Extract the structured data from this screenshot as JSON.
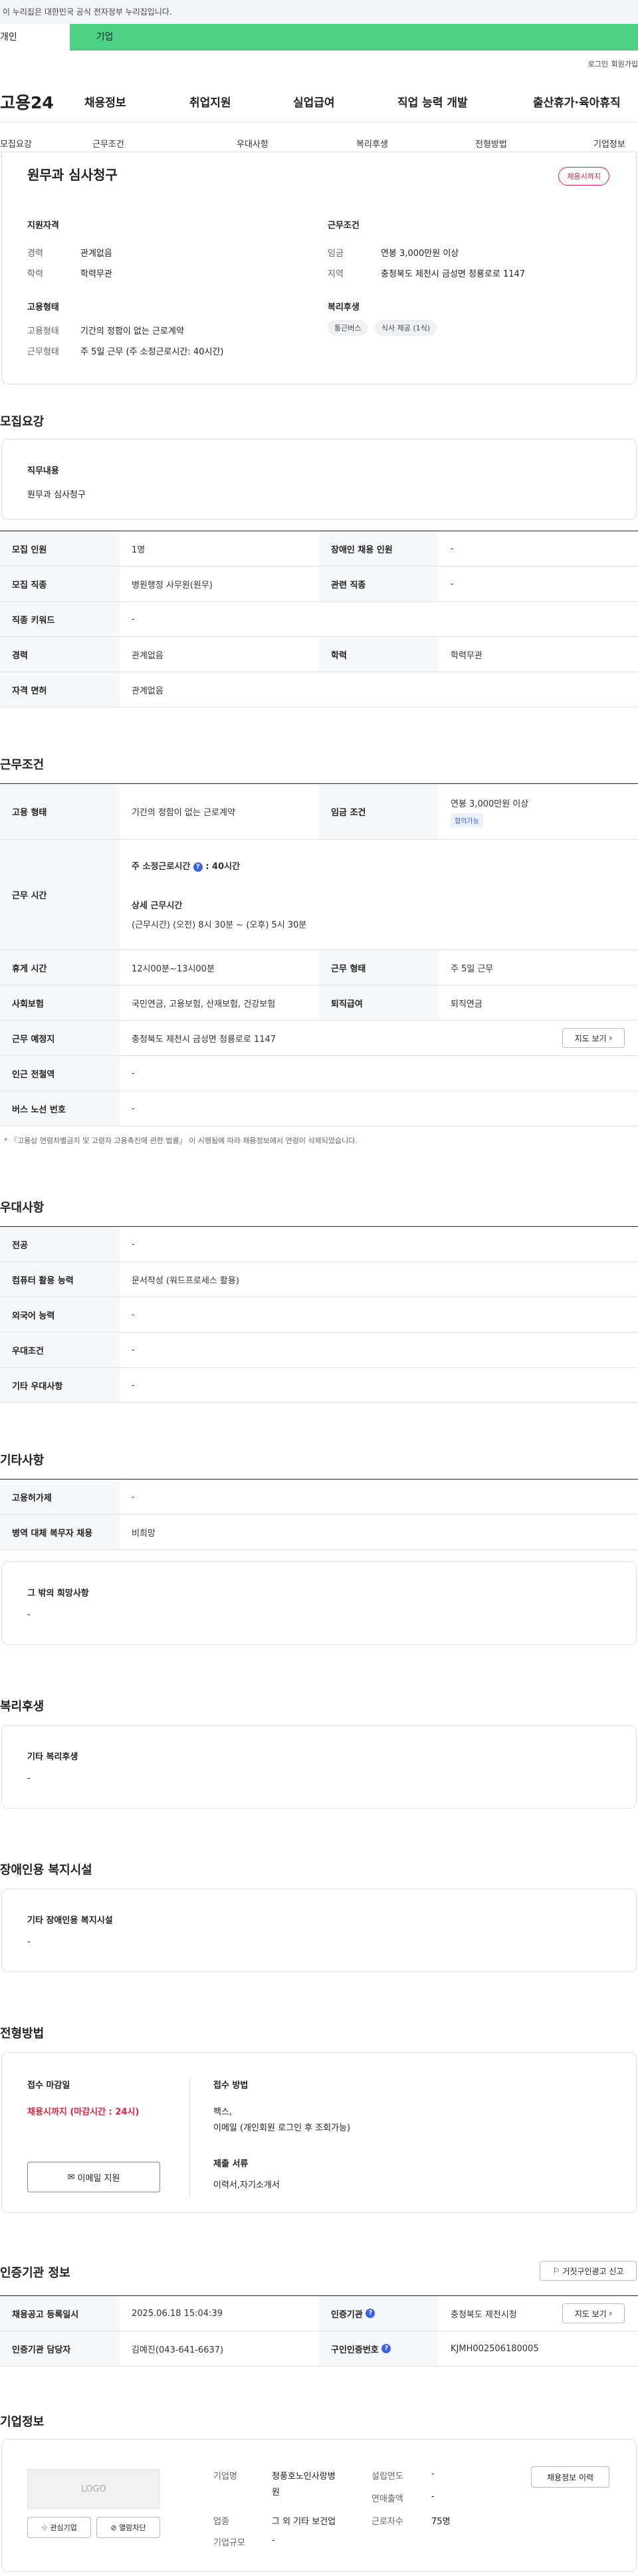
{
  "gov_banner": "이 누리집은 대한민국 공식 전자정부 누리집입니다.",
  "user_tabs": [
    "개인",
    "기업"
  ],
  "top_links": [
    "로그인",
    "회원가입"
  ],
  "logo": "고용24",
  "gnb": [
    "채용정보",
    "취업지원",
    "실업급여",
    "직업 능력 개발",
    "출산휴가·육아휴직"
  ],
  "subnav": [
    "모집요강",
    "근무조건",
    "우대사항",
    "복리후생",
    "전형방법",
    "기업정보"
  ],
  "summary": {
    "title": "원무과 심사청구",
    "status": "채용시까지",
    "qual_head": "지원자격",
    "career_l": "경력",
    "career_v": "관계없음",
    "edu_l": "학력",
    "edu_v": "학력무관",
    "emp_head": "고용형태",
    "emptype_l": "고용형태",
    "emptype_v": "기간의 정함이 없는 근로계약",
    "worktype_l": "근무형태",
    "worktype_v": "주 5일 근무 (주 소정근로시간: 40시간)",
    "cond_head": "근무조건",
    "wage_l": "임금",
    "wage_v": "연봉 3,000만원 이상",
    "area_l": "지역",
    "area_v": "충청북도 제천시 금성면 청룡로로 1147",
    "welfare_head": "복리후생",
    "welfare_tags": [
      "통근버스",
      "식사 제공 (1식)"
    ]
  },
  "recruit": {
    "title": "모집요강",
    "duty_head": "직무내용",
    "duty_v": "원무과 심사청구",
    "rows": {
      "count_l": "모집 인원",
      "count_v": "1명",
      "disabled_l": "장애인 채용 인원",
      "disabled_v": "-",
      "job_l": "모집 직종",
      "job_v": "병원행정 사무원(원무)",
      "related_l": "관련 직종",
      "related_v": "-",
      "kw_l": "직종 키워드",
      "kw_v": "-",
      "career_l": "경력",
      "career_v": "관계없음",
      "edu_l": "학력",
      "edu_v": "학력무관",
      "license_l": "자격 면허",
      "license_v": "관계없음"
    }
  },
  "work": {
    "title": "근무조건",
    "emp_l": "고용 형태",
    "emp_v": "기간의 정함이 없는 근로계약",
    "wage_l": "임금 조건",
    "wage_v": "연봉 3,000만원 이상",
    "wage_badge": "협의가능",
    "time_l": "근무 시간",
    "time_weekly": "주 소정근로시간",
    "time_weekly_v": ": 40시간",
    "time_detail_head": "상세 근무시간",
    "time_detail_v": "(근무시간) (오전) 8시 30분 ~ (오후) 5시 30분",
    "break_l": "휴게 시간",
    "break_v": "12시00분~13시00분",
    "wtype_l": "근무 형태",
    "wtype_v": "주 5일 근무",
    "ins_l": "사회보험",
    "ins_v": "국민연금, 고용보험, 산재보험, 건강보험",
    "retire_l": "퇴직급여",
    "retire_v": "퇴직연금",
    "place_l": "근무 예정지",
    "place_v": "충청북도 제천시 금성면 청룡로로 1147",
    "map_btn": "지도 보기",
    "station_l": "인근 전철역",
    "station_v": "-",
    "bus_l": "버스 노선 번호",
    "bus_v": "-",
    "note": "* 『고용상 연령차별금지 및 고령자 고용촉진에 관한 법률』 이 시행됨에 따라 채용정보에서 연령이 삭제되었습니다."
  },
  "prefer": {
    "title": "우대사항",
    "major_l": "전공",
    "major_v": "-",
    "pc_l": "컴퓨터 활용 능력",
    "pc_v": "문서작성 (워드프로세스 활용)",
    "lang_l": "외국어 능력",
    "lang_v": "-",
    "cond_l": "우대조건",
    "cond_v": "-",
    "etc_l": "기타 우대사항",
    "etc_v": "-"
  },
  "etc": {
    "title": "기타사항",
    "corp_l": "고용허가제",
    "corp_v": "-",
    "military_l": "병역 대체 복무자 채용",
    "military_v": "비희망",
    "wish_head": "그 밖의 희망사항",
    "wish_v": "-"
  },
  "welfare": {
    "title": "복리후생",
    "head": "기타 복리후생",
    "v": "-"
  },
  "disabled": {
    "title": "장애인용 복지시설",
    "head": "기타 장애인용 복지시설",
    "v": "-"
  },
  "selection": {
    "title": "전형방법",
    "deadline_head": "접수 마감일",
    "deadline_v": "채용시까지 (마감시간 : 24시)",
    "email_btn": "이메일 지원",
    "method_head": "접수 방법",
    "method_v1": "팩스,",
    "method_v2": "이메일 (개인회원 로그인 후 조회가능)",
    "docs_head": "제출 서류",
    "docs_v": "이력서,자기소개서"
  },
  "agency": {
    "title": "인증기관 정보",
    "report_btn": "거짓구인광고 신고",
    "reg_l": "채용공고 등록일시",
    "reg_v": "2025.06.18 15:04:39",
    "org_l": "인증기관",
    "org_v": "충청북도 제천시청",
    "map_btn": "지도 보기",
    "mgr_l": "인증기관 담당자",
    "mgr_v": "김예진(043-641-6637)",
    "num_l": "구인인증번호",
    "num_v": "KJMH002506180005"
  },
  "company": {
    "title": "기업정보",
    "logo": "LOGO",
    "fav_btn": "관심기업",
    "block_btn": "열람차단",
    "name_l": "기업명",
    "name_v1": "청풍호노인사랑병",
    "name_v2": "원",
    "ind_l": "업종",
    "ind_v": "그 외 기타 보건업",
    "size_l": "기업규모",
    "size_v": "-",
    "year_l": "설립연도",
    "year_v": "-",
    "sales_l": "연매출액",
    "sales_v": "-",
    "emp_l": "근로자수",
    "emp_v": "75명",
    "history_btn": "채용정보 이력"
  }
}
